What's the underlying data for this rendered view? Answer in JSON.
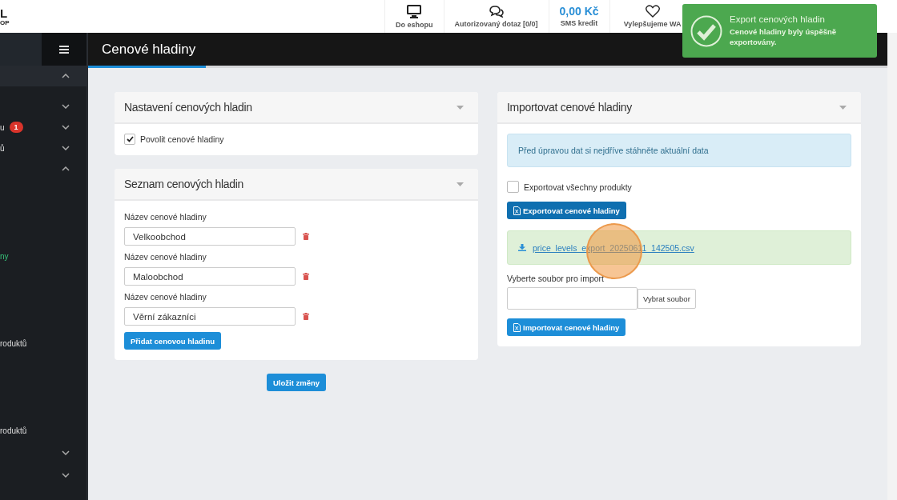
{
  "logo": {
    "mark": "L",
    "sub": "OP"
  },
  "top_nav": [
    {
      "kind": "monitor",
      "label": "Do eshopu"
    },
    {
      "kind": "chat",
      "label": "Autorizovaný dotaz [0/0]"
    },
    {
      "kind": "amount",
      "value": "0,00 Kč",
      "label": "SMS kredit"
    },
    {
      "kind": "heart",
      "label": "Vylepšujeme WA"
    }
  ],
  "toast": {
    "title": "Export cenových hladin",
    "message": "Cenové hladiny byly úspěšně exportovány."
  },
  "page_title": "Cenové hladiny",
  "sidebar": {
    "items": [
      {
        "kind": "section",
        "expanded": true
      },
      {
        "kind": "group",
        "expanded": false
      },
      {
        "kind": "group",
        "text": "u",
        "badge": "1",
        "expanded": false
      },
      {
        "kind": "group",
        "text": "ů",
        "expanded": false
      },
      {
        "kind": "group",
        "expanded": true
      },
      {
        "kind": "link",
        "text": "ny",
        "selected": true
      },
      {
        "kind": "link",
        "text": "roduktů",
        "selected": false
      },
      {
        "kind": "link",
        "text": "roduktů",
        "selected": false
      },
      {
        "kind": "group",
        "expanded": false
      },
      {
        "kind": "group",
        "expanded": false
      }
    ]
  },
  "settings_card": {
    "title": "Nastavení cenových hladin",
    "checkbox": {
      "label": "Povolit cenové hladiny",
      "checked": true
    }
  },
  "levels_card": {
    "title": "Seznam cenových hladin",
    "levels": [
      {
        "label": "Název cenové hladiny",
        "value": "Velkoobchod"
      },
      {
        "label": "Název cenové hladiny",
        "value": "Maloobchod"
      },
      {
        "label": "Název cenové hladiny",
        "value": "Věrní zákazníci"
      }
    ],
    "add_button": "Přidat cenovou hladinu"
  },
  "save_button": "Uložit změny",
  "import_card": {
    "title": "Importovat cenové hladiny",
    "info": "Před úpravou dat si nejdříve stáhněte aktuální data",
    "export_all": {
      "label": "Exportovat všechny produkty",
      "checked": false
    },
    "export_button": "Exportovat cenové hladiny",
    "download_link": "price_levels_export_20250611_142505.csv",
    "file_label": "Vyberte soubor pro import",
    "browse_button": "Vybrat soubor",
    "import_button": "Importovat cenové hladiny"
  }
}
